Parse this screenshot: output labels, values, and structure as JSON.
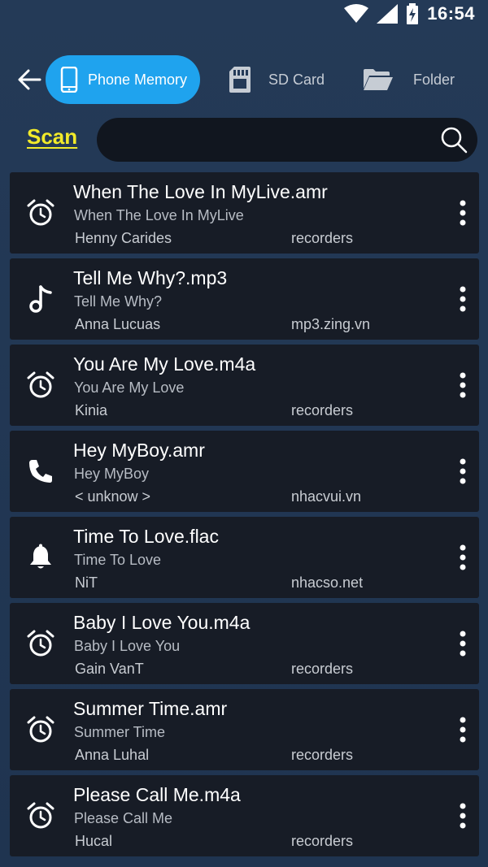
{
  "status_bar": {
    "time": "16:54",
    "icons": [
      "wifi-icon",
      "signal-icon",
      "battery-charging-icon"
    ]
  },
  "tabs": [
    {
      "label": "Phone Memory",
      "icon": "phone-icon",
      "active": true
    },
    {
      "label": "SD Card",
      "icon": "sd-card-icon",
      "active": false
    },
    {
      "label": "Folder",
      "icon": "folder-icon",
      "active": false
    }
  ],
  "search": {
    "scan_label": "Scan",
    "placeholder": "",
    "value": ""
  },
  "items": [
    {
      "title": "When The Love In MyLive.amr",
      "subtitle": "When The Love In MyLive",
      "artist": "Henny Carides",
      "source": "recorders",
      "icon": "alarm-icon"
    },
    {
      "title": "Tell Me Why?.mp3",
      "subtitle": "Tell Me Why?",
      "artist": "Anna Lucuas",
      "source": "mp3.zing.vn",
      "icon": "music-note-icon"
    },
    {
      "title": "You Are My Love.m4a",
      "subtitle": "You Are My Love",
      "artist": "Kinia",
      "source": "recorders",
      "icon": "alarm-icon"
    },
    {
      "title": "Hey MyBoy.amr",
      "subtitle": "Hey MyBoy",
      "artist": "< unknow >",
      "source": "nhacvui.vn",
      "icon": "phone-call-icon"
    },
    {
      "title": "Time To Love.flac",
      "subtitle": "Time To Love",
      "artist": "NiT",
      "source": "nhacso.net",
      "icon": "bell-icon"
    },
    {
      "title": "Baby I Love You.m4a",
      "subtitle": "Baby I Love You",
      "artist": "Gain VanT",
      "source": "recorders",
      "icon": "alarm-icon"
    },
    {
      "title": "Summer Time.amr",
      "subtitle": "Summer Time",
      "artist": "Anna Luhal",
      "source": "recorders",
      "icon": "alarm-icon"
    },
    {
      "title": "Please Call Me.m4a",
      "subtitle": "Please Call Me",
      "artist": "Hucal",
      "source": "recorders",
      "icon": "alarm-icon"
    }
  ],
  "colors": {
    "accent": "#1fa3ee",
    "scan": "#f2ea2a",
    "card": "#171c26",
    "search_bg": "#11161f"
  }
}
